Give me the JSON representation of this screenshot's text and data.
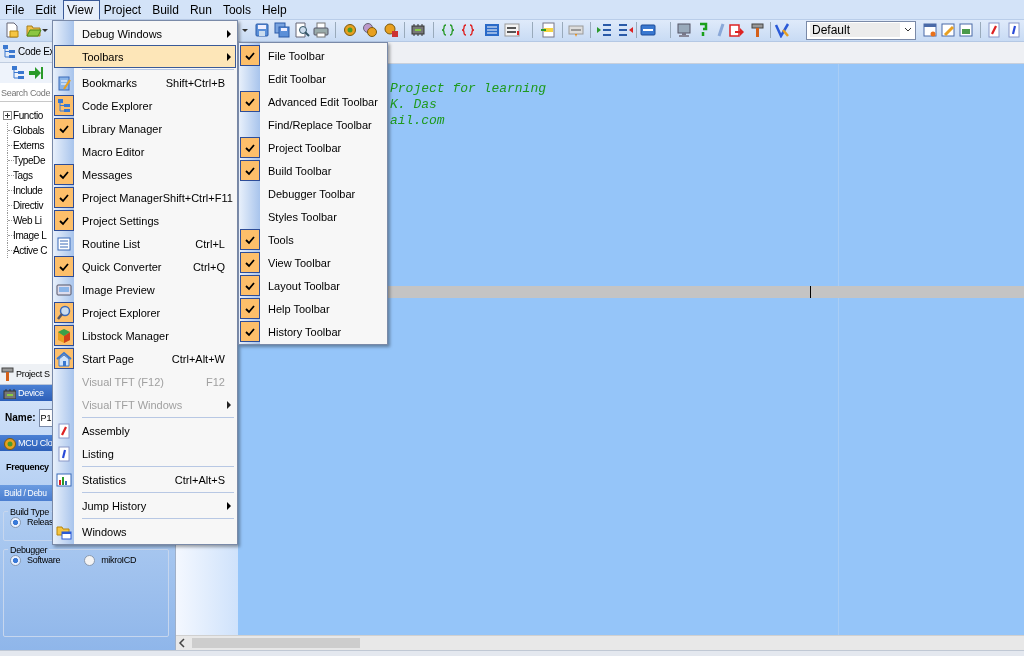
{
  "menu_bar": [
    {
      "label": "File",
      "selected": false
    },
    {
      "label": "Edit",
      "selected": false
    },
    {
      "label": "View",
      "selected": true
    },
    {
      "label": "Project",
      "selected": false
    },
    {
      "label": "Build",
      "selected": false
    },
    {
      "label": "Run",
      "selected": false
    },
    {
      "label": "Tools",
      "selected": false
    },
    {
      "label": "Help",
      "selected": false
    }
  ],
  "toolbar": {
    "style_combo": {
      "value": "Default"
    }
  },
  "code_explorer": {
    "title": "Code Ex",
    "search": {
      "placeholder": "Search Code"
    },
    "tree": [
      {
        "label": "Functio",
        "expanded": false
      },
      {
        "label": "Globals"
      },
      {
        "label": "Externs"
      },
      {
        "label": "TypeDe"
      },
      {
        "label": "Tags"
      },
      {
        "label": "Include"
      },
      {
        "label": "Directiv"
      },
      {
        "label": "Web Li"
      },
      {
        "label": "Image L"
      },
      {
        "label": "Active C"
      }
    ]
  },
  "project_settings": {
    "title": "Project S",
    "device": {
      "header": "Device",
      "name_label": "Name:",
      "name_value": "P1"
    },
    "mcu_clock": {
      "header": "MCU Clo",
      "frequency_label": "Frequency"
    },
    "build_debug": {
      "header": "Build / Debu",
      "build_type": {
        "title": "Build Type",
        "options": [
          {
            "label": "Releas",
            "selected": true
          }
        ]
      },
      "debugger": {
        "title": "Debugger",
        "options": [
          {
            "label": "Software",
            "selected": true
          },
          {
            "label": "mikroICD",
            "selected": false
          }
        ]
      }
    }
  },
  "editor": {
    "lines": [
      "Project for learning",
      "K. Das",
      "ail.com"
    ]
  },
  "view_menu": {
    "items": [
      {
        "kind": "submenu",
        "label": "Debug Windows",
        "selected": false,
        "checked": false,
        "disabled": false
      },
      {
        "kind": "submenu",
        "label": "Toolbars",
        "selected": true,
        "checked": false,
        "disabled": false
      },
      {
        "kind": "separator"
      },
      {
        "kind": "command",
        "label": "Bookmarks",
        "shortcut": "Shift+Ctrl+B",
        "selected": false,
        "checked": false,
        "disabled": false
      },
      {
        "kind": "command",
        "label": "Code Explorer",
        "selected": false,
        "checked": true,
        "disabled": false
      },
      {
        "kind": "command",
        "label": "Library Manager",
        "selected": false,
        "checked": true,
        "disabled": false
      },
      {
        "kind": "command",
        "label": "Macro Editor",
        "selected": false,
        "checked": false,
        "disabled": false
      },
      {
        "kind": "command",
        "label": "Messages",
        "selected": false,
        "checked": true,
        "disabled": false
      },
      {
        "kind": "command",
        "label": "Project Manager",
        "shortcut": "Shift+Ctrl+F11",
        "selected": false,
        "checked": true,
        "disabled": false
      },
      {
        "kind": "command",
        "label": "Project Settings",
        "selected": false,
        "checked": true,
        "disabled": false
      },
      {
        "kind": "command",
        "label": "Routine List",
        "shortcut": "Ctrl+L",
        "selected": false,
        "checked": false,
        "disabled": false
      },
      {
        "kind": "command",
        "label": "Quick Converter",
        "shortcut": "Ctrl+Q",
        "selected": false,
        "checked": true,
        "disabled": false
      },
      {
        "kind": "command",
        "label": "Image Preview",
        "selected": false,
        "checked": false,
        "disabled": false
      },
      {
        "kind": "command",
        "label": "Project Explorer",
        "selected": false,
        "checked": true,
        "disabled": false
      },
      {
        "kind": "command",
        "label": "Libstock Manager",
        "selected": false,
        "checked": true,
        "disabled": false
      },
      {
        "kind": "command",
        "label": "Start Page",
        "shortcut": "Ctrl+Alt+W",
        "selected": false,
        "checked": true,
        "disabled": false
      },
      {
        "kind": "command",
        "label": "Visual TFT (F12)",
        "shortcut": "F12",
        "selected": false,
        "checked": false,
        "disabled": true
      },
      {
        "kind": "submenu",
        "label": "Visual TFT Windows",
        "selected": false,
        "checked": false,
        "disabled": true
      },
      {
        "kind": "separator"
      },
      {
        "kind": "command",
        "label": "Assembly",
        "selected": false,
        "checked": false,
        "disabled": false
      },
      {
        "kind": "command",
        "label": "Listing",
        "selected": false,
        "checked": false,
        "disabled": false
      },
      {
        "kind": "separator"
      },
      {
        "kind": "command",
        "label": "Statistics",
        "shortcut": "Ctrl+Alt+S",
        "selected": false,
        "checked": false,
        "disabled": false
      },
      {
        "kind": "separator"
      },
      {
        "kind": "submenu",
        "label": "Jump History",
        "selected": false,
        "checked": false,
        "disabled": false
      },
      {
        "kind": "separator"
      },
      {
        "kind": "command",
        "label": "Windows",
        "selected": false,
        "checked": false,
        "disabled": false
      }
    ]
  },
  "toolbars_submenu": {
    "items": [
      {
        "label": "File Toolbar",
        "selected": false,
        "checked": true,
        "disabled": false
      },
      {
        "label": "Edit Toolbar",
        "selected": false,
        "checked": false,
        "disabled": false
      },
      {
        "label": "Advanced Edit Toolbar",
        "selected": false,
        "checked": true,
        "disabled": false
      },
      {
        "label": "Find/Replace Toolbar",
        "selected": false,
        "checked": false,
        "disabled": false
      },
      {
        "label": "Project Toolbar",
        "selected": false,
        "checked": true,
        "disabled": false
      },
      {
        "label": "Build Toolbar",
        "selected": false,
        "checked": true,
        "disabled": false
      },
      {
        "label": "Debugger Toolbar",
        "selected": false,
        "checked": false,
        "disabled": false
      },
      {
        "label": "Styles Toolbar",
        "selected": false,
        "checked": false,
        "disabled": false
      },
      {
        "label": "Tools",
        "selected": false,
        "checked": true,
        "disabled": false
      },
      {
        "label": "View Toolbar",
        "selected": false,
        "checked": true,
        "disabled": false
      },
      {
        "label": "Layout Toolbar",
        "selected": false,
        "checked": true,
        "disabled": false
      },
      {
        "label": "Help Toolbar",
        "selected": false,
        "checked": true,
        "disabled": false
      },
      {
        "label": "History Toolbar",
        "selected": false,
        "checked": true,
        "disabled": false
      }
    ]
  }
}
